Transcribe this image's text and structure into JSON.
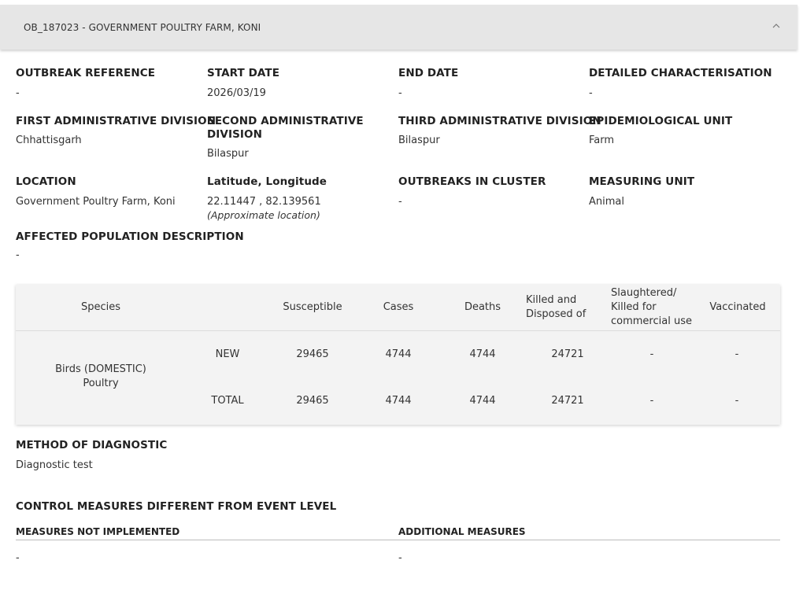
{
  "header": {
    "title": "OB_187023 - GOVERNMENT POULTRY FARM, KONI",
    "toggle_icon": "chevron-up-icon"
  },
  "details": {
    "outbreak_reference": {
      "label": "OUTBREAK REFERENCE",
      "value": "-"
    },
    "start_date": {
      "label": "START DATE",
      "value": "2026/03/19"
    },
    "end_date": {
      "label": "END DATE",
      "value": "-"
    },
    "detailed_characterisation": {
      "label": "DETAILED CHARACTERISATION",
      "value": "-"
    },
    "first_admin_division": {
      "label": "FIRST ADMINISTRATIVE DIVISION",
      "value": "Chhattisgarh"
    },
    "second_admin_division": {
      "label_line1": "SECOND ADMINISTRATIVE",
      "label_line2": "DIVISION",
      "value": "Bilaspur"
    },
    "third_admin_division": {
      "label": "THIRD ADMINISTRATIVE DIVISION",
      "value": "Bilaspur"
    },
    "epidemiological_unit": {
      "label": "EPIDEMIOLOGICAL UNIT",
      "value": "Farm"
    },
    "location": {
      "label": "LOCATION",
      "value": "Government Poultry Farm, Koni"
    },
    "lat_long": {
      "label": "Latitude, Longitude",
      "value": "22.11447 , 82.139561",
      "note": "(Approximate location)"
    },
    "outbreaks_in_cluster": {
      "label": "OUTBREAKS IN CLUSTER",
      "value": "-"
    },
    "measuring_unit": {
      "label": "MEASURING UNIT",
      "value": "Animal"
    },
    "affected_population": {
      "label": "AFFECTED POPULATION DESCRIPTION",
      "value": "-"
    }
  },
  "table": {
    "columns": {
      "species": "Species",
      "susceptible": "Susceptible",
      "cases": "Cases",
      "deaths": "Deaths",
      "killed_line1": "Killed and",
      "killed_line2": "Disposed of",
      "slaughtered_line1": "Slaughtered/",
      "slaughtered_line2": "Killed for",
      "slaughtered_line3": "commercial use",
      "vaccinated": "Vaccinated"
    },
    "species_line1": "Birds (DOMESTIC)",
    "species_line2": "Poultry",
    "rows": [
      {
        "type": "NEW",
        "susceptible": "29465",
        "cases": "4744",
        "deaths": "4744",
        "killed": "24721",
        "slaughtered": "-",
        "vaccinated": "-"
      },
      {
        "type": "TOTAL",
        "susceptible": "29465",
        "cases": "4744",
        "deaths": "4744",
        "killed": "24721",
        "slaughtered": "-",
        "vaccinated": "-"
      }
    ]
  },
  "diagnostic": {
    "label": "METHOD OF DIAGNOSTIC",
    "value": "Diagnostic test"
  },
  "control_measures": {
    "title": "CONTROL MEASURES DIFFERENT FROM EVENT LEVEL",
    "not_implemented_label": "MEASURES NOT IMPLEMENTED",
    "not_implemented_value": "-",
    "additional_label": "ADDITIONAL MEASURES",
    "additional_value": "-"
  }
}
